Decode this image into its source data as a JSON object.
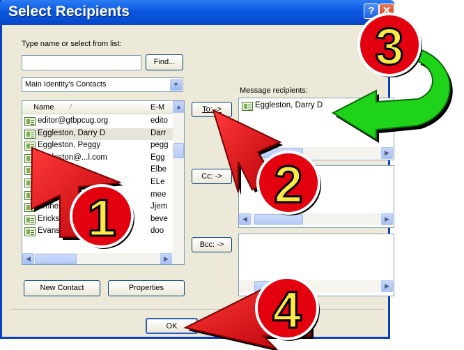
{
  "dialog": {
    "title": "Select Recipients",
    "help_glyph": "?",
    "close_glyph": "✕"
  },
  "search": {
    "label": "Type name or select from list:",
    "value": "",
    "find_button": "Find..."
  },
  "address_book": {
    "selected": "Main Identity's Contacts",
    "arrow": "▼"
  },
  "contacts_list": {
    "columns": [
      "Name",
      "E-M"
    ],
    "sort_glyph": "/",
    "rows": [
      {
        "name": "editor@gtbpcug.org",
        "email": "edito",
        "selected": false
      },
      {
        "name": "Eggleston, Darry D",
        "email": "Darr",
        "selected": true
      },
      {
        "name": "Eggleston, Peggy",
        "email": "pegg",
        "selected": false
      },
      {
        "name": "Eggleston@...l.com",
        "email": "Egg",
        "selected": false
      },
      {
        "name": "E...com",
        "email": "Elbe",
        "selected": false
      },
      {
        "name": "EL...27(...",
        "email": "ELe",
        "selected": false
      },
      {
        "name": "Elli...",
        "email": "mee",
        "selected": false
      },
      {
        "name": "Emnett, ...",
        "email": "Jjem",
        "selected": false
      },
      {
        "name": "Erickson, ...",
        "email": "beve",
        "selected": false
      },
      {
        "name": "Evans, Alicia",
        "email": "doo",
        "selected": false
      }
    ]
  },
  "buttons": {
    "to": "To: ->",
    "cc": "Cc: ->",
    "bcc": "Bcc: ->",
    "new_contact": "New Contact",
    "properties": "Properties",
    "ok": "OK"
  },
  "recipients": {
    "label": "Message recipients:",
    "to": [
      "Eggleston, Darry D"
    ],
    "cc": [],
    "bcc": []
  },
  "callouts": [
    "1",
    "2",
    "3",
    "4"
  ],
  "colors": {
    "callout_red": "#e3000f",
    "arrow_green": "#1fd31a",
    "titlebar_blue": "#0a58e0"
  }
}
